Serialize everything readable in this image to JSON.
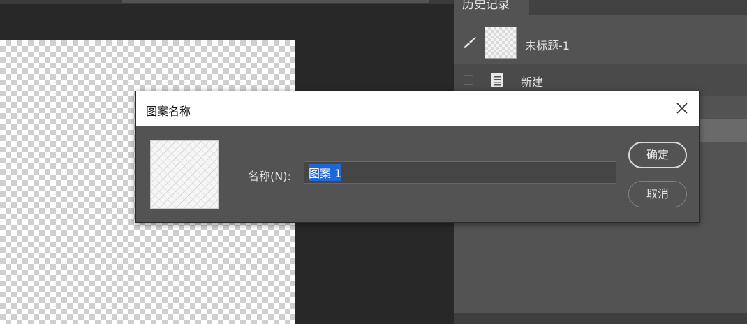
{
  "panel": {
    "tab_label": "历史记录",
    "history_items": [
      {
        "label": "未标题-1",
        "icon": "document-snapshot-icon"
      },
      {
        "label": "新建",
        "icon": "new-document-icon"
      }
    ]
  },
  "dialog": {
    "title": "图案名称",
    "name_label": "名称(N):",
    "name_value": "图案 1",
    "ok_label": "确定",
    "cancel_label": "取消"
  },
  "colors": {
    "accent": "#2f6fcf",
    "selection": "#1f66d6",
    "panel": "#535353",
    "workspace": "#282828"
  }
}
